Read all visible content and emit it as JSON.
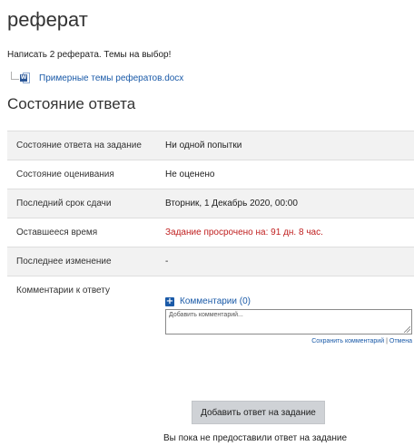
{
  "page": {
    "title": "реферат",
    "intro": "Написать 2 реферата. Темы на выбор!"
  },
  "attachment": {
    "icon": "word-document-icon",
    "icon_letter": "W",
    "filename": "Примерные темы рефератов.docx"
  },
  "status": {
    "heading": "Состояние ответа",
    "rows": [
      {
        "label": "Состояние ответа на задание",
        "value": "Ни одной попытки"
      },
      {
        "label": "Состояние оценивания",
        "value": "Не оценено"
      },
      {
        "label": "Последний срок сдачи",
        "value": "Вторник, 1 Декабрь 2020, 00:00"
      },
      {
        "label": "Оставшееся время",
        "value": "Задание просрочено на: 91 дн. 8 час."
      },
      {
        "label": "Последнее изменение",
        "value": "-"
      },
      {
        "label": "Комментарии к ответу",
        "value": ""
      }
    ]
  },
  "comments": {
    "toggle_label": "Комментарии (0)",
    "placeholder": "Добавить комментарий...",
    "save_label": "Сохранить комментарий",
    "separator": "|",
    "cancel_label": "Отмена"
  },
  "actions": {
    "submit_label": "Добавить ответ на задание",
    "no_submission_text": "Вы пока не предоставили ответ на задание"
  },
  "colors": {
    "link": "#1a5aa8",
    "overdue": "#c02020",
    "row_shade": "#f2f2f2",
    "button_bg": "#cfd2d6"
  }
}
